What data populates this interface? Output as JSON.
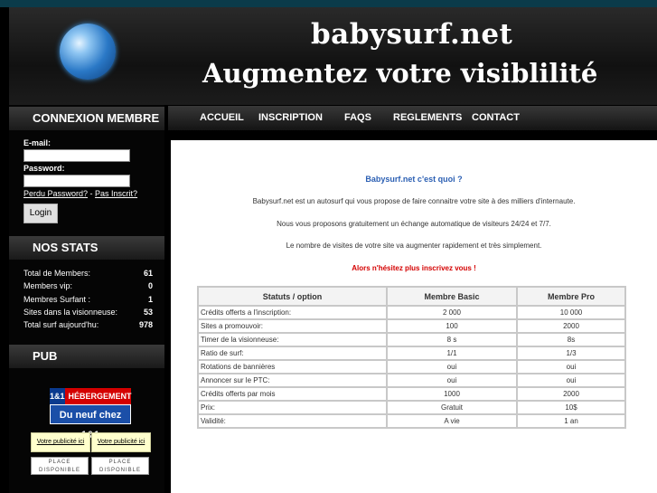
{
  "header": {
    "site_name": "babysurf.net",
    "tagline": "Augmentez votre visiblilité"
  },
  "nav": [
    "ACCUEIL",
    "INSCRIPTION",
    "FAQS",
    "REGLEMENTS",
    "CONTACT"
  ],
  "sidebar": {
    "login": {
      "title": "CONNEXION MEMBRE",
      "email_label": "E-mail:",
      "password_label": "Password:",
      "forgot_link": "Perdu Password?",
      "separator": " - ",
      "register_link": "Pas Inscrit?",
      "button": "Login"
    },
    "stats": {
      "title": "NOS STATS",
      "rows": [
        {
          "label": "Total de Members:",
          "value": "61"
        },
        {
          "label": "Members vip:",
          "value": "0"
        },
        {
          "label": "Membres Surfant :",
          "value": "1"
        },
        {
          "label": "Sites dans la visionneuse:",
          "value": "53"
        },
        {
          "label": "Total surf aujourd'hu:",
          "value": "978"
        }
      ]
    },
    "pub": {
      "title": "PUB",
      "banner_number": "1&1",
      "banner_top": "HÉBERGEMENT",
      "banner_bottom": "Du neuf chez 1&1",
      "ad_slot_1": "Votre publicité ici",
      "ad_slot_2": "Votre publicité ici",
      "place_1_line1": "PLACE",
      "place_1_line2": "DISPONIBLE",
      "place_2_line1": "PLACE",
      "place_2_line2": "DISPONIBLE"
    }
  },
  "main": {
    "title": "Babysurf.net c'est quoi ?",
    "paragraphs": [
      "Babysurf.net est un autosurf qui vous propose de faire connaitre votre site à des milliers d'internaute.",
      "Nous vous proposons gratuitement un échange automatique de visiteurs 24/24 et 7/7.",
      "Le nombre de visites de votre site va augmenter rapidement et très simplement."
    ],
    "cta": "Alors n'hésitez plus inscrivez vous !",
    "table": {
      "headers": [
        "Statuts / option",
        "Membre Basic",
        "Membre Pro"
      ],
      "rows": [
        [
          "Crédits offerts a l'inscription:",
          "2 000",
          "10 000"
        ],
        [
          "Sites a promouvoir:",
          "100",
          "2000"
        ],
        [
          "Timer de la visionneuse:",
          "8 s",
          "8s"
        ],
        [
          "Ratio de surf:",
          "1/1",
          "1/3"
        ],
        [
          "Rotations de bannières",
          "oui",
          "oui"
        ],
        [
          "Annoncer sur le PTC:",
          "oui",
          "oui"
        ],
        [
          "Crédits offerts par mois",
          "1000",
          "2000"
        ],
        [
          "Prix:",
          "Gratuit",
          "10$"
        ],
        [
          "Validité:",
          "A vie",
          "1 an"
        ]
      ]
    }
  }
}
